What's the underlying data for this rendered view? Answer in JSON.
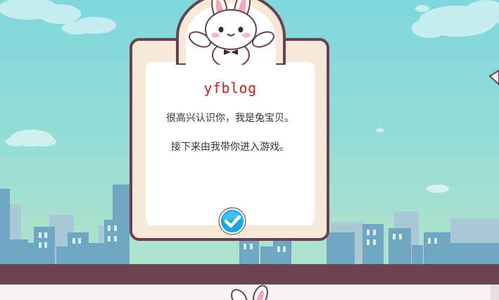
{
  "dialog": {
    "title": "yfblog",
    "line1": "很高兴认识你，我是兔宝贝。",
    "line2": "接下来由我带你进入游戏。"
  },
  "icons": {
    "confirm": "check-icon",
    "mascot": "rabbit-mascot",
    "bottom_mascot": "rabbit-ears"
  },
  "colors": {
    "sky_top": "#7fd7dc",
    "sky_bottom": "#b4e4cb",
    "ground": "#6b4352",
    "dialog_border": "#6a4152",
    "dialog_fill": "#f6e9d8",
    "title": "#cc1f1f",
    "confirm_button": "#1aa3e6"
  }
}
